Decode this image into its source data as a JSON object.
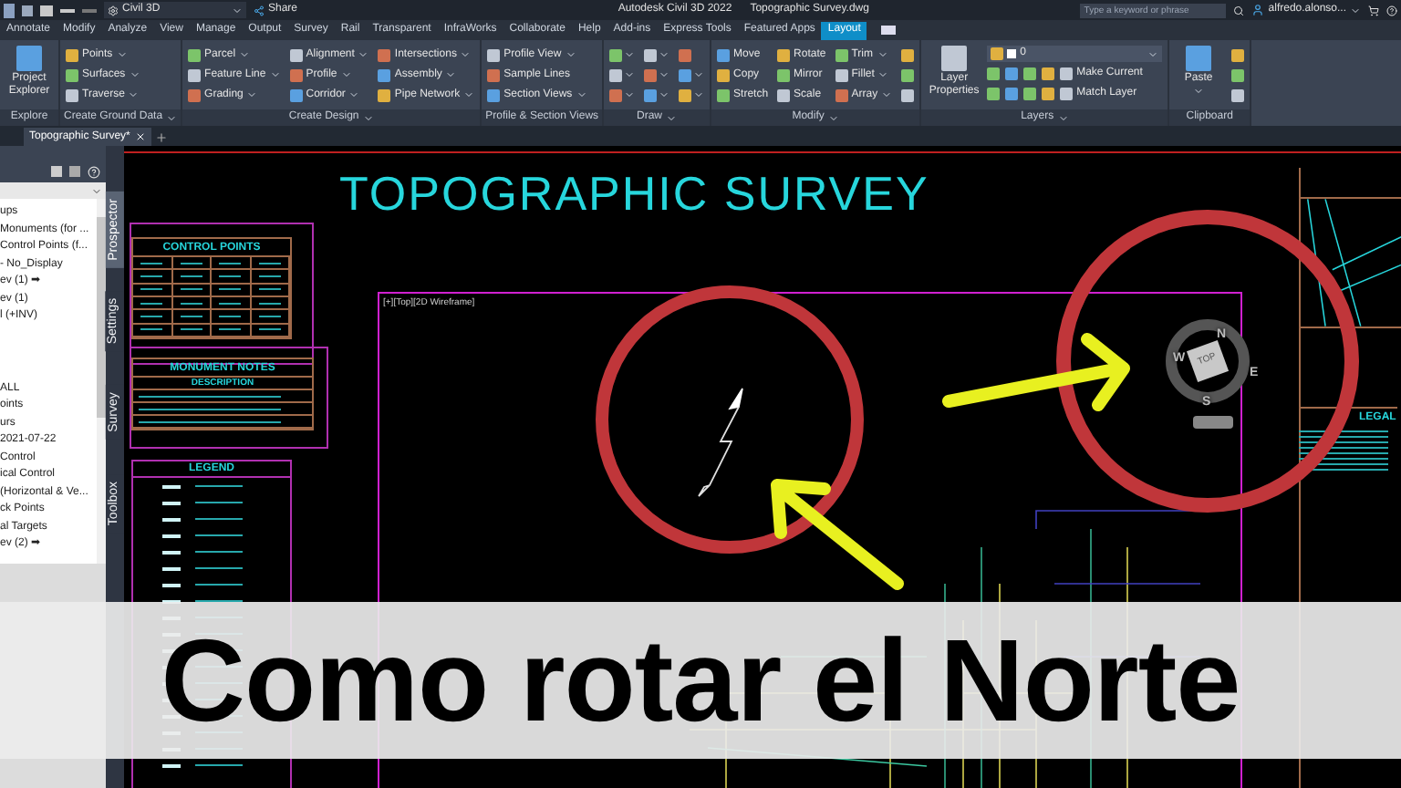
{
  "title_bar": {
    "workspace": "Civil 3D",
    "share": "Share",
    "app_title": "Autodesk Civil 3D 2022",
    "file_name": "Topographic Survey.dwg",
    "search": {
      "placeholder": "Type a keyword or phrase"
    },
    "user": "alfredo.alonso..."
  },
  "ribbon_tabs": [
    {
      "label": "Annotate",
      "selected": false
    },
    {
      "label": "Modify",
      "selected": false
    },
    {
      "label": "Analyze",
      "selected": false
    },
    {
      "label": "View",
      "selected": false
    },
    {
      "label": "Manage",
      "selected": false
    },
    {
      "label": "Output",
      "selected": false
    },
    {
      "label": "Survey",
      "selected": false
    },
    {
      "label": "Rail",
      "selected": false
    },
    {
      "label": "Transparent",
      "selected": false
    },
    {
      "label": "InfraWorks",
      "selected": false
    },
    {
      "label": "Collaborate",
      "selected": false
    },
    {
      "label": "Help",
      "selected": false
    },
    {
      "label": "Add-ins",
      "selected": false
    },
    {
      "label": "Express Tools",
      "selected": false
    },
    {
      "label": "Featured Apps",
      "selected": false
    },
    {
      "label": "Layout",
      "selected": true
    }
  ],
  "ribbon_panels": [
    {
      "kind": "tools",
      "title": "Explore",
      "dropdown": false,
      "columns": [
        [
          {
            "kind": "large",
            "label": "Project Explorer",
            "dropdown": false
          }
        ]
      ]
    },
    {
      "kind": "tools",
      "title": "Create Ground Data",
      "dropdown": true,
      "columns": [
        [
          {
            "kind": "small",
            "label": "Points",
            "dropdown": true
          },
          {
            "kind": "small",
            "label": "Surfaces",
            "dropdown": true
          },
          {
            "kind": "small",
            "label": "Traverse",
            "dropdown": true
          }
        ]
      ]
    },
    {
      "kind": "tools",
      "title": "Create Design",
      "dropdown": true,
      "columns": [
        [
          {
            "kind": "small",
            "label": "Parcel",
            "dropdown": true
          },
          {
            "kind": "small",
            "label": "Feature Line",
            "dropdown": true
          },
          {
            "kind": "small",
            "label": "Grading",
            "dropdown": true
          }
        ],
        [
          {
            "kind": "small",
            "label": "Alignment",
            "dropdown": true
          },
          {
            "kind": "small",
            "label": "Profile",
            "dropdown": true
          },
          {
            "kind": "small",
            "label": "Corridor",
            "dropdown": true
          }
        ],
        [
          {
            "kind": "small",
            "label": "Intersections",
            "dropdown": true
          },
          {
            "kind": "small",
            "label": "Assembly",
            "dropdown": true
          },
          {
            "kind": "small",
            "label": "Pipe Network",
            "dropdown": true
          }
        ]
      ]
    },
    {
      "kind": "tools",
      "title": "Profile & Section Views",
      "dropdown": false,
      "columns": [
        [
          {
            "kind": "small",
            "label": "Profile View",
            "dropdown": true
          },
          {
            "kind": "small",
            "label": "Sample Lines",
            "dropdown": false
          },
          {
            "kind": "small",
            "label": "Section Views",
            "dropdown": true
          }
        ]
      ]
    },
    {
      "kind": "tools",
      "title": "Draw",
      "dropdown": true,
      "columns": [
        [
          {
            "kind": "icon",
            "dropdown": true
          },
          {
            "kind": "icon",
            "dropdown": true
          },
          {
            "kind": "icon",
            "dropdown": true
          }
        ],
        [
          {
            "kind": "icon",
            "dropdown": true
          },
          {
            "kind": "icon",
            "dropdown": true
          },
          {
            "kind": "icon",
            "dropdown": true
          }
        ],
        [
          {
            "kind": "icon",
            "dropdown": false
          },
          {
            "kind": "icon",
            "dropdown": true
          },
          {
            "kind": "icon",
            "dropdown": true
          }
        ]
      ]
    },
    {
      "kind": "tools",
      "title": "Modify",
      "dropdown": true,
      "columns": [
        [
          {
            "kind": "small",
            "label": "Move",
            "dropdown": false
          },
          {
            "kind": "small",
            "label": "Copy",
            "dropdown": false
          },
          {
            "kind": "small",
            "label": "Stretch",
            "dropdown": false
          }
        ],
        [
          {
            "kind": "small",
            "label": "Rotate",
            "dropdown": false
          },
          {
            "kind": "small",
            "label": "Mirror",
            "dropdown": false
          },
          {
            "kind": "small",
            "label": "Scale",
            "dropdown": false
          }
        ],
        [
          {
            "kind": "small",
            "label": "Trim",
            "dropdown": true
          },
          {
            "kind": "small",
            "label": "Fillet",
            "dropdown": true
          },
          {
            "kind": "small",
            "label": "Array",
            "dropdown": true
          }
        ],
        [
          {
            "kind": "icon",
            "dropdown": false
          },
          {
            "kind": "icon",
            "dropdown": false
          },
          {
            "kind": "icon",
            "dropdown": false
          }
        ]
      ]
    },
    {
      "kind": "layers",
      "title": "Layers",
      "dropdown": true,
      "large": "Layer Properties",
      "layer_value": "0",
      "actions": [
        "Make Current",
        "Match Layer"
      ]
    },
    {
      "kind": "tools",
      "title": "Clipboard",
      "dropdown": false,
      "columns": [
        [
          {
            "kind": "large",
            "label": "Paste",
            "dropdown": true
          }
        ],
        [
          {
            "kind": "icon",
            "dropdown": false
          },
          {
            "kind": "icon",
            "dropdown": false
          },
          {
            "kind": "icon",
            "dropdown": false
          }
        ]
      ]
    }
  ],
  "document_tabs": [
    {
      "label": "Topographic Survey*",
      "selected": true
    }
  ],
  "toolspace": {
    "tree_groups": [
      [
        "ups",
        "Monuments (for ...",
        "Control Points (f...",
        "- No_Display",
        "ev (1) ➡",
        "ev (1)",
        "l (+INV)"
      ],
      [
        "ALL",
        "oints",
        "urs",
        "2021-07-22",
        "Control",
        "ical Control",
        "(Horizontal & Ve...",
        "ck Points",
        "al Targets",
        "ev (2) ➡"
      ]
    ],
    "vertical_tabs": [
      {
        "label": "Prospector",
        "selected": true
      },
      {
        "label": "Settings",
        "selected": false
      },
      {
        "label": "Survey",
        "selected": false
      },
      {
        "label": "Toolbox",
        "selected": false
      }
    ]
  },
  "drawing": {
    "title": "TOPOGRAPHIC SURVEY",
    "tables": [
      {
        "title": "CONTROL POINTS"
      },
      {
        "title": "MONUMENT NOTES",
        "subtitle": "DESCRIPTION"
      },
      {
        "title": "LEGEND"
      }
    ],
    "viewport_label": "[+][Top][2D Wireframe]",
    "view_cube": {
      "face": "TOP",
      "directions": [
        "N",
        "E",
        "S",
        "W"
      ]
    },
    "sheet_label": "LEGAL"
  },
  "banner": {
    "title": "Como rotar el Norte"
  }
}
